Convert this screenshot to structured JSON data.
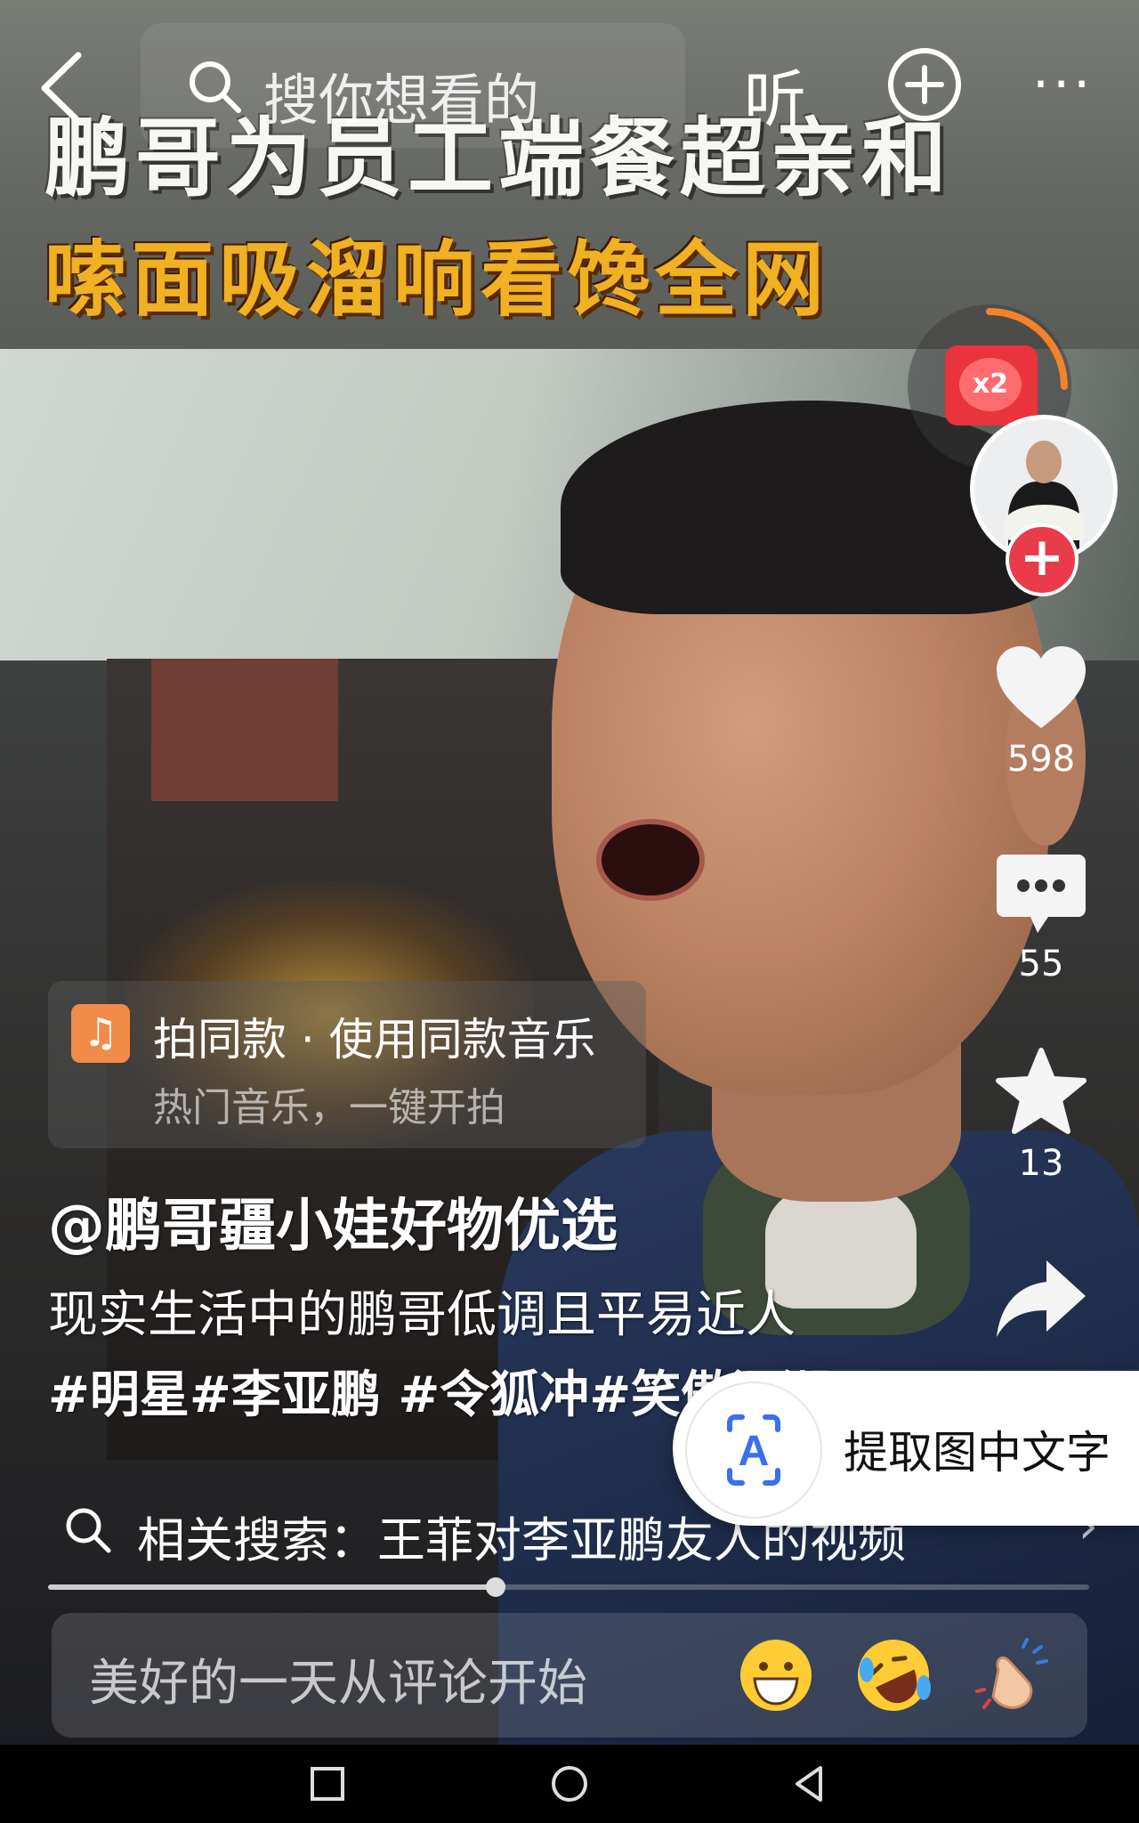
{
  "video": {
    "title_line1": "鹏哥为员工端餐超亲和",
    "title_line2": "嗦面吸溜响看馋全网"
  },
  "topbar": {
    "search_placeholder": "搜你想看的",
    "listen_label": "听",
    "more_label": "···"
  },
  "redpacket": {
    "multiplier": "x2"
  },
  "actions": {
    "like_count": "598",
    "comment_count": "55",
    "favorite_count": "13"
  },
  "music": {
    "title": "拍同款 · 使用同款音乐",
    "subtitle": "热门音乐，一键开拍"
  },
  "caption": {
    "author": "@鹏哥疆小娃好物优选",
    "description": "现实生活中的鹏哥低调且平易近人",
    "hashtags": "#明星#李亚鹏 #令狐冲#笑傲江湖"
  },
  "extract_text": {
    "label": "提取图中文字"
  },
  "related_search": {
    "text": "相关搜索：王菲对李亚鹏友人的视频"
  },
  "progress": {
    "fraction": 0.43
  },
  "comment_input": {
    "placeholder": "美好的一天从评论开始",
    "emojis": [
      "grinning-face",
      "rolling-laughing-face",
      "clapping-hands"
    ]
  },
  "colors": {
    "accent_red": "#EA3B4A",
    "music_orange": "#F28A4A",
    "title_gold": "#F0B122"
  }
}
